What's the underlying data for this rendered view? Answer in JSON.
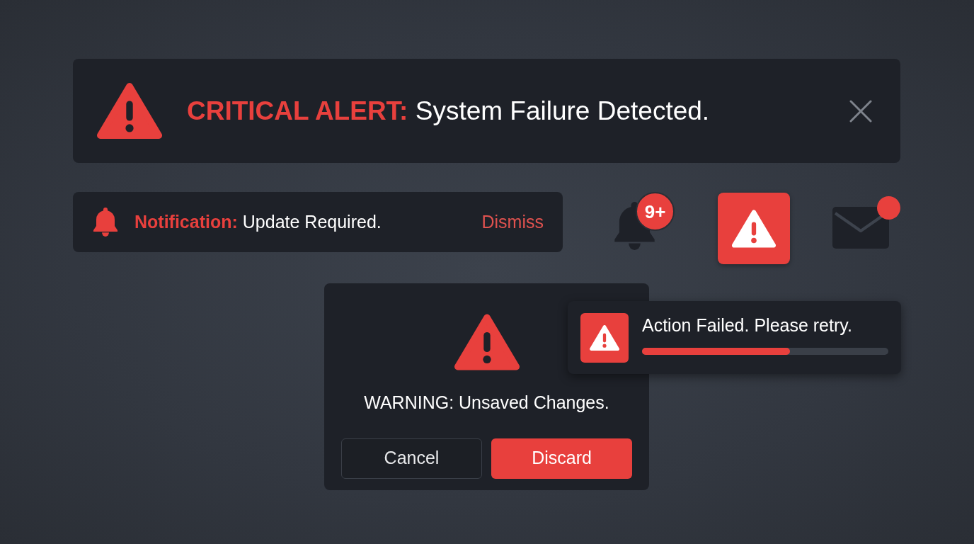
{
  "critical_alert": {
    "message": "**CRITICAL ALERT:** System Failure Detected."
  },
  "notification_bar": {
    "message": "**Notification:** Update Required.",
    "action": "Dismiss"
  },
  "status_icons": [
    {
      "kind": "bell",
      "badge": "9+"
    },
    {
      "kind": "alert"
    },
    {
      "kind": "mail",
      "unread": true
    }
  ],
  "dialog": {
    "message": "WARNING: Unsaved Changes.",
    "buttons": [
      {
        "label": "Cancel",
        "kind": "secondary"
      },
      {
        "label": "Discard",
        "kind": "primary"
      }
    ]
  },
  "toast": {
    "message": "Action Failed. Please retry.",
    "level": 0.6
  }
}
